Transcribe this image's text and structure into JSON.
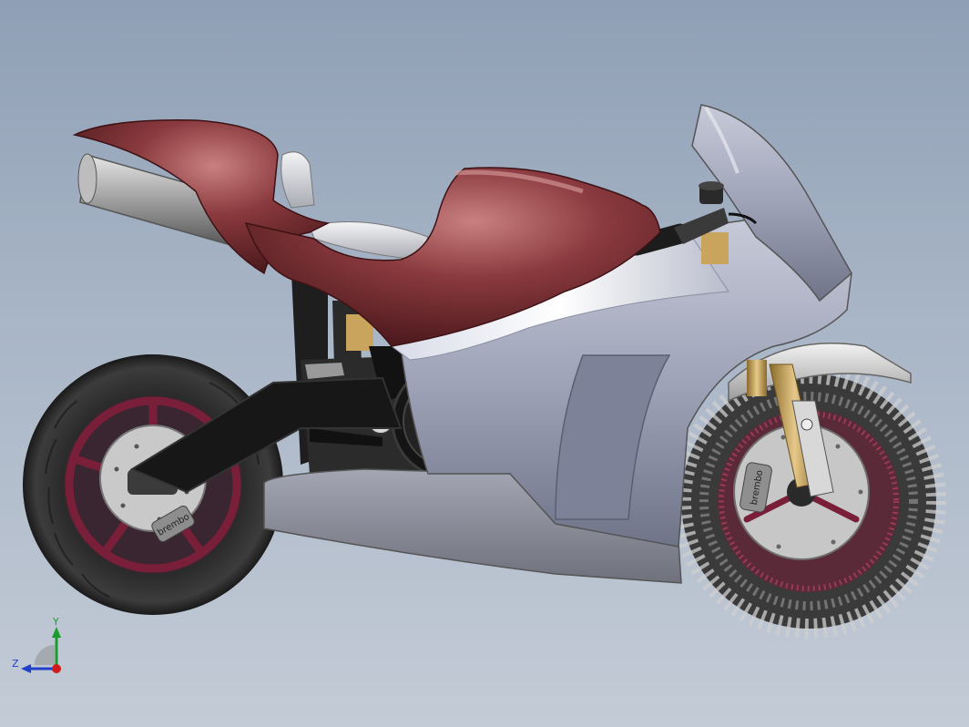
{
  "viewport": {
    "background_top": "#8f9fb5",
    "background_bottom": "#c3cbd6"
  },
  "model": {
    "colors": {
      "bodywork": "#7a2e33",
      "fairing": "#9ea3b8",
      "rims": "#7a1f3a",
      "tire": "#2a2a2a",
      "frame": "#1f1f1f",
      "fork": "#c9a45c"
    },
    "caliper_text_front": "brembo",
    "caliper_text_rear": "brembo"
  },
  "triad": {
    "y_label": "Y",
    "z_label": "Z",
    "y_color": "#1a9c2c",
    "z_color": "#2340c8",
    "x_color": "#d11a1a"
  }
}
